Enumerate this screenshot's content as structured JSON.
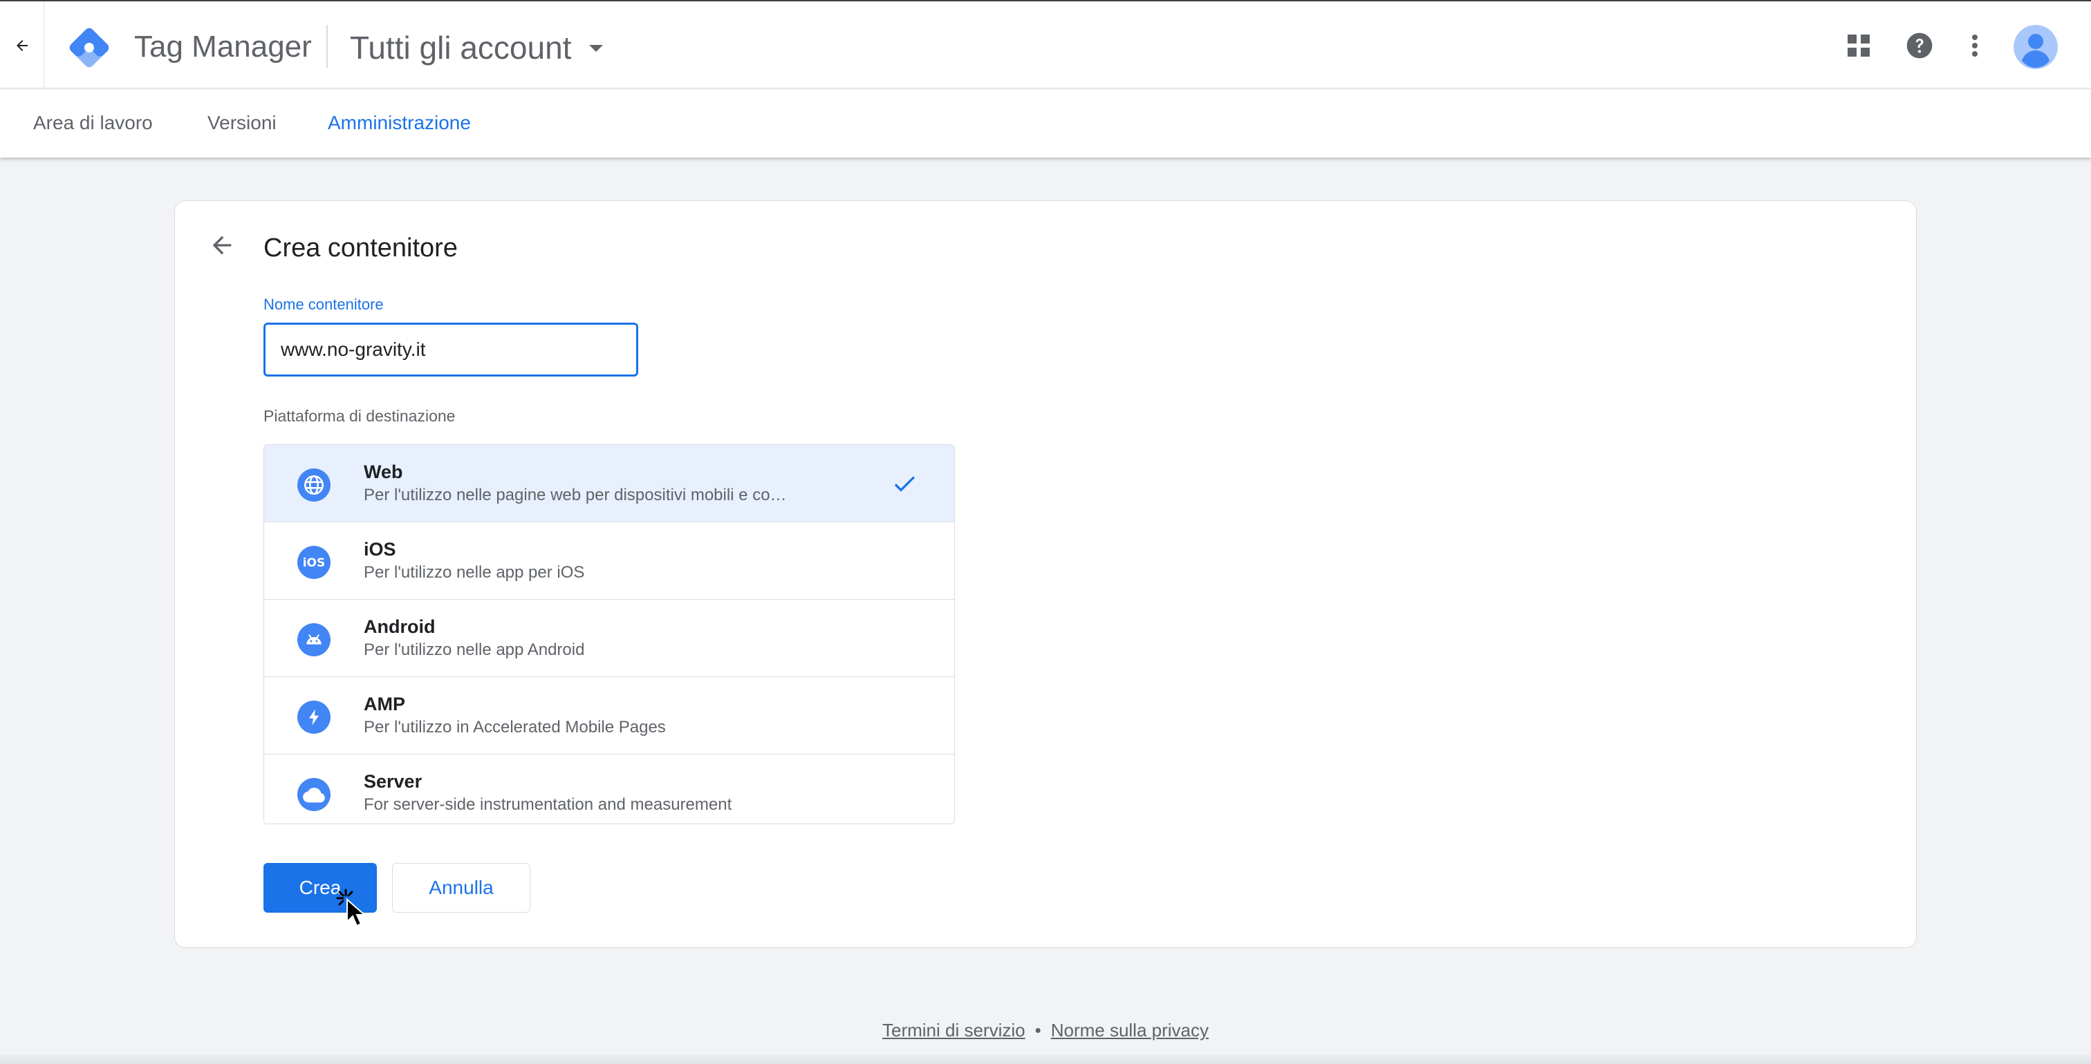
{
  "header": {
    "product_name": "Tag Manager",
    "account_label": "Tutti gli account"
  },
  "tabs": [
    {
      "label": "Area di lavoro",
      "active": false
    },
    {
      "label": "Versioni",
      "active": false
    },
    {
      "label": "Amministrazione",
      "active": true
    }
  ],
  "form": {
    "title": "Crea contenitore",
    "name_label": "Nome contenitore",
    "name_value": "www.no-gravity.it",
    "platform_label": "Piattaforma di destinazione",
    "platforms": [
      {
        "name": "Web",
        "description": "Per l'utilizzo nelle pagine web per dispositivi mobili e co…",
        "icon": "globe-icon",
        "selected": true
      },
      {
        "name": "iOS",
        "description": "Per l'utilizzo nelle app per iOS",
        "icon": "ios-icon",
        "selected": false
      },
      {
        "name": "Android",
        "description": "Per l'utilizzo nelle app Android",
        "icon": "android-icon",
        "selected": false
      },
      {
        "name": "AMP",
        "description": "Per l'utilizzo in Accelerated Mobile Pages",
        "icon": "lightning-icon",
        "selected": false
      },
      {
        "name": "Server",
        "description": "For server-side instrumentation and measurement",
        "icon": "cloud-icon",
        "selected": false
      }
    ],
    "create_label": "Crea",
    "cancel_label": "Annulla"
  },
  "footer": {
    "terms": "Termini di servizio",
    "separator": "•",
    "privacy": "Norme sulla privacy"
  },
  "colors": {
    "accent": "#1a73e8",
    "selected_row": "#e8f0fe",
    "icon_blue": "#4285f4",
    "page_bg": "#f1f3f4"
  }
}
